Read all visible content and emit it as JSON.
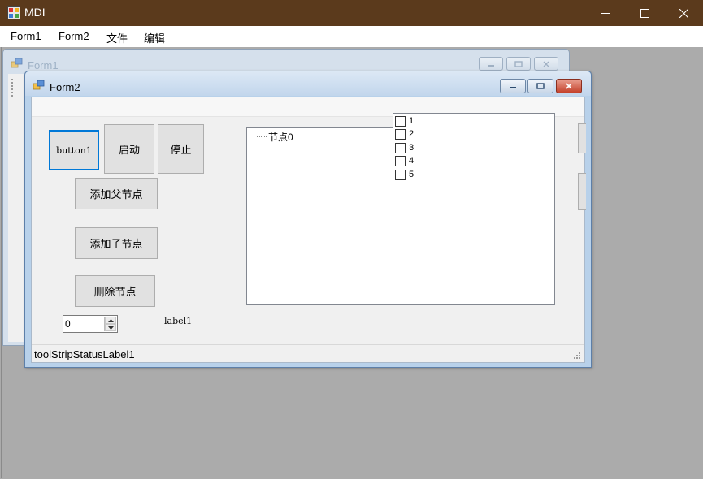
{
  "app": {
    "title": "MDI"
  },
  "menu": {
    "items": [
      "Form1",
      "Form2",
      "文件",
      "编辑"
    ]
  },
  "form1": {
    "title": "Form1"
  },
  "form2": {
    "title": "Form2",
    "buttons": {
      "button1": "button1",
      "start": "启动",
      "stop": "停止",
      "add_parent": "添加父节点",
      "add_child": "添加子节点",
      "delete": "删除节点"
    },
    "numeric": {
      "value": "0"
    },
    "label1": "label1",
    "tree": {
      "nodes": [
        "节点0"
      ]
    },
    "checklist": {
      "items": [
        "1",
        "2",
        "3",
        "4",
        "5"
      ]
    },
    "status": {
      "label": "toolStripStatusLabel1"
    }
  },
  "colors": {
    "titlebar": "#5b3a1c",
    "mdi_background": "#ababab",
    "button_focus": "#0078d7"
  }
}
